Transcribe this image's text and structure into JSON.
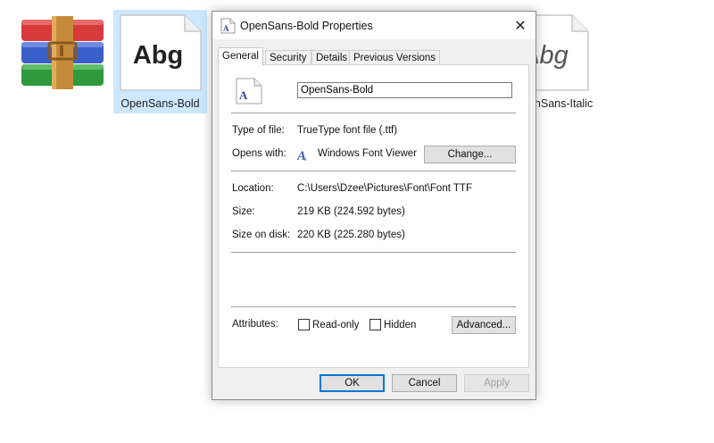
{
  "desktop": {
    "files": [
      {
        "label": "OpenSans-Bold",
        "sample": "Abg"
      },
      {
        "label": "penSans-Italic",
        "sample": "Abg"
      }
    ]
  },
  "dialog": {
    "title": "OpenSans-Bold Properties",
    "tabs": [
      "General",
      "Security",
      "Details",
      "Previous Versions"
    ],
    "active_tab": "General",
    "file_name": "OpenSans-Bold",
    "type_of_file_label": "Type of file:",
    "type_of_file": "TrueType font file (.ttf)",
    "opens_with_label": "Opens with:",
    "opens_with": "Windows Font Viewer",
    "change_button": "Change...",
    "location_label": "Location:",
    "location": "C:\\Users\\Dzee\\Pictures\\Font\\Font TTF",
    "size_label": "Size:",
    "size": "219 KB (224.592 bytes)",
    "size_on_disk_label": "Size on disk:",
    "size_on_disk": "220 KB (225.280 bytes)",
    "attributes_label": "Attributes:",
    "readonly_label": "Read-only",
    "hidden_label": "Hidden",
    "advanced_button": "Advanced...",
    "ok_button": "OK",
    "cancel_button": "Cancel",
    "apply_button": "Apply"
  },
  "colors": {
    "selection": "#cce8ff",
    "accent": "#0078d7",
    "dialog_bg": "#f0f0f0"
  }
}
